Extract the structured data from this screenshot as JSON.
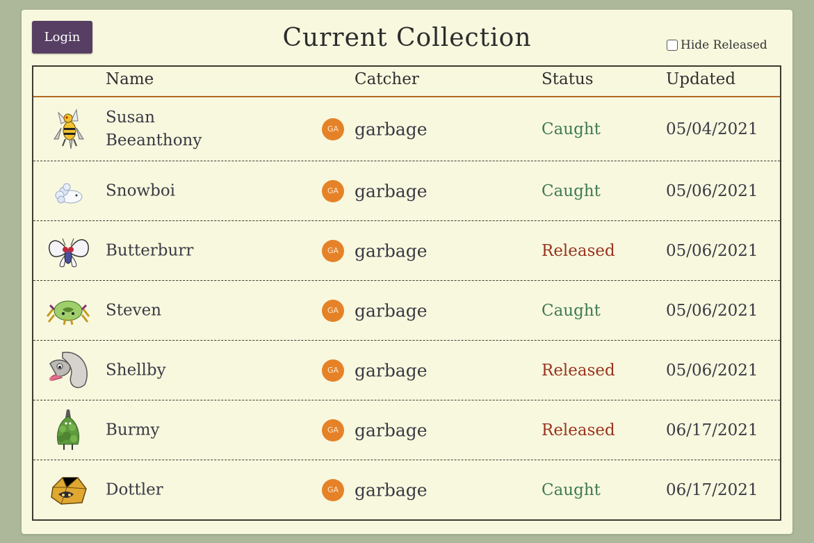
{
  "header": {
    "login_label": "Login",
    "title": "Current Collection",
    "hide_released_label": "Hide Released",
    "hide_released_checked": false
  },
  "table": {
    "columns": [
      "Name",
      "Catcher",
      "Status",
      "Updated"
    ],
    "rows": [
      {
        "name": "Susan Beeanthony",
        "sprite": "beedrill-icon",
        "catcher_initials": "GA",
        "catcher": "garbage",
        "status": "Caught",
        "updated": "05/04/2021"
      },
      {
        "name": "Snowboi",
        "sprite": "snom-icon",
        "catcher_initials": "GA",
        "catcher": "garbage",
        "status": "Caught",
        "updated": "05/06/2021"
      },
      {
        "name": "Butterburr",
        "sprite": "butterfree-icon",
        "catcher_initials": "GA",
        "catcher": "garbage",
        "status": "Released",
        "updated": "05/06/2021"
      },
      {
        "name": "Steven",
        "sprite": "spinarak-icon",
        "catcher_initials": "GA",
        "catcher": "garbage",
        "status": "Caught",
        "updated": "05/06/2021"
      },
      {
        "name": "Shellby",
        "sprite": "shellder-icon",
        "catcher_initials": "GA",
        "catcher": "garbage",
        "status": "Released",
        "updated": "05/06/2021"
      },
      {
        "name": "Burmy",
        "sprite": "burmy-icon",
        "catcher_initials": "GA",
        "catcher": "garbage",
        "status": "Released",
        "updated": "06/17/2021"
      },
      {
        "name": "Dottler",
        "sprite": "dottler-icon",
        "catcher_initials": "GA",
        "catcher": "garbage",
        "status": "Caught",
        "updated": "06/17/2021"
      }
    ]
  },
  "colors": {
    "background": "#adb89a",
    "card": "#f8f8df",
    "login_button": "#563f63",
    "header_rule": "#b36a22",
    "caught": "#3e7a52",
    "released": "#99341e",
    "avatar": "#e58228"
  }
}
